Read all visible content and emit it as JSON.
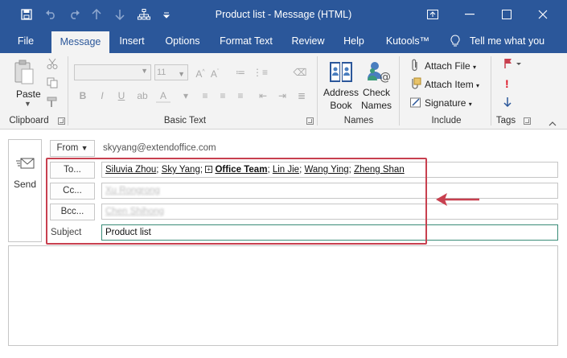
{
  "window": {
    "title": "Product list  -  Message (HTML)",
    "quick_access": [
      "save-icon",
      "undo-icon",
      "redo-icon",
      "up-arrow-icon",
      "down-arrow-icon",
      "hierarchy-icon",
      "customize-icon"
    ],
    "controls": [
      "restore-icon",
      "minimize-icon",
      "maximize-icon",
      "close-icon"
    ]
  },
  "tabs": [
    "File",
    "Message",
    "Insert",
    "Options",
    "Format Text",
    "Review",
    "Help",
    "Kutools™",
    "Tell me what you"
  ],
  "active_tab": "Message",
  "ribbon": {
    "clipboard": {
      "label": "Clipboard",
      "paste": "Paste"
    },
    "basic_text": {
      "label": "Basic Text",
      "font_size": "11"
    },
    "names": {
      "label": "Names",
      "address_book_1": "Address",
      "address_book_2": "Book",
      "check_names_1": "Check",
      "check_names_2": "Names"
    },
    "include": {
      "label": "Include",
      "attach_file": "Attach File",
      "attach_item": "Attach Item",
      "signature": "Signature"
    },
    "tags": {
      "label": "Tags"
    }
  },
  "compose": {
    "send": "Send",
    "from_label": "From",
    "from_value": "skyyang@extendoffice.com",
    "to_label": "To...",
    "cc_label": "Cc...",
    "bcc_label": "Bcc...",
    "subject_label": "Subject",
    "subject_value": "Product list",
    "to_recipients": [
      "Siluvia Zhou",
      "Sky Yang",
      "Office Team",
      "Lin Jie",
      "Wang Ying",
      "Zheng Shan"
    ],
    "cc_recipient": "Xu Rongrong",
    "bcc_recipient": "Chen Shihong"
  },
  "colors": {
    "accent": "#2b579a",
    "highlight": "#c8404f",
    "ribbon_bg": "#f3f3f3"
  }
}
